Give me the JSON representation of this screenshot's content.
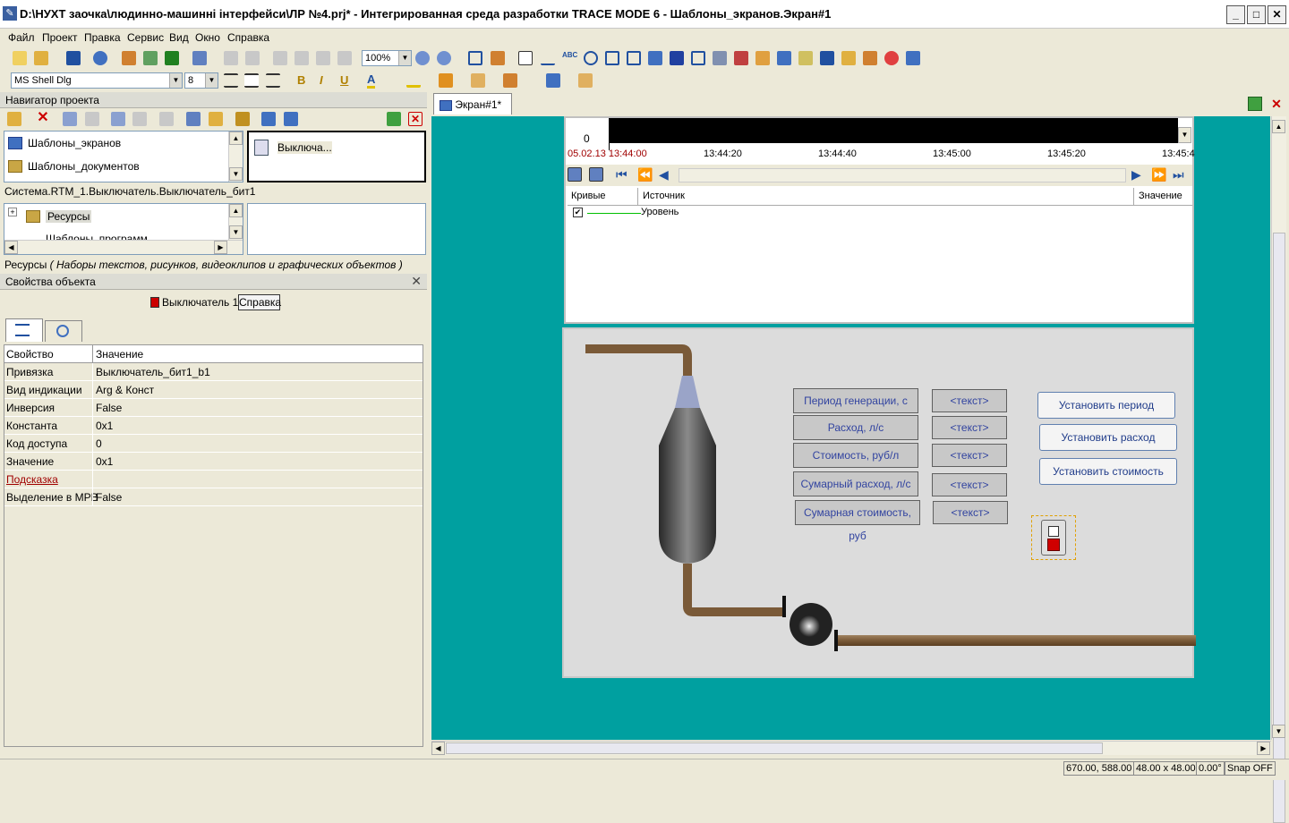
{
  "window": {
    "title": "D:\\НУХТ заочка\\людинно-машинні інтерфейси\\ЛР №4.prj* - Интегрированная среда разработки TRACE MODE 6 - Шаблоны_экранов.Экран#1",
    "min_label": "_",
    "max_label": "□",
    "close_label": "✕"
  },
  "menu": [
    "Файл",
    "Проект",
    "Правка",
    "Сервис",
    "Вид",
    "Окно",
    "Справка"
  ],
  "toolbar": {
    "zoom_value": "100%",
    "font_name": "MS Shell Dlg",
    "font_size": "8",
    "bold_label": "B",
    "italic_label": "I",
    "underline_label": "U",
    "font_color_label": "A"
  },
  "navigator": {
    "title": "Навигатор проекта",
    "tree_top": [
      "Шаблоны_экранов",
      "Шаблоны_документов"
    ],
    "right_item": "Выключа...",
    "path": "Система.RTM_1.Выключатель.Выключатель_бит1",
    "tree_bottom": [
      "Ресурсы",
      "Шаблоны_программ"
    ],
    "resources_status_bold": "Ресурсы",
    "resources_status_italic": "( Наборы текстов, рисунков, видеоклипов и графических объектов )"
  },
  "properties": {
    "title": "Свойства объекта",
    "object_name": "Выключатель 1",
    "help_button": "Справка",
    "col_property": "Свойство",
    "col_value": "Значение",
    "rows": [
      {
        "k": "Привязка",
        "v": "Выключатель_бит1_b1"
      },
      {
        "k": "Вид индикации",
        "v": "Arg & Конст"
      },
      {
        "k": "Инверсия",
        "v": "False"
      },
      {
        "k": "Константа",
        "v": "0x1"
      },
      {
        "k": "Код доступа",
        "v": "0"
      },
      {
        "k": "Значение",
        "v": "0x1"
      },
      {
        "k": "Подсказка",
        "v": ""
      },
      {
        "k": "Выделение в МРВ",
        "v": "False"
      }
    ]
  },
  "doc_tab": "Экран#1*",
  "trend": {
    "zero_label": "0",
    "date_label": "05.02.13 13:44:00",
    "times": [
      "13:44:20",
      "13:44:40",
      "13:45:00",
      "13:45:20",
      "13:45:4"
    ],
    "col_curves": "Кривые",
    "col_source": "Источник",
    "col_value": "Значение",
    "curve_name": "Уровень",
    "curve_color": "#00c000"
  },
  "scene": {
    "labels": [
      "Период генерации, с",
      "Расход, л/с",
      "Стоимость, руб/л",
      "Сумарный расход, л/с",
      "Сумарная стоимость, руб"
    ],
    "text_placeholder": "<текст>",
    "actions": [
      "Установить период",
      "Установить расход",
      "Установить стоимость"
    ]
  },
  "status": {
    "coords": "670.00, 588.00",
    "size": "48.00 x 48.00",
    "angle": "0.00°",
    "snap": "Snap OFF"
  }
}
